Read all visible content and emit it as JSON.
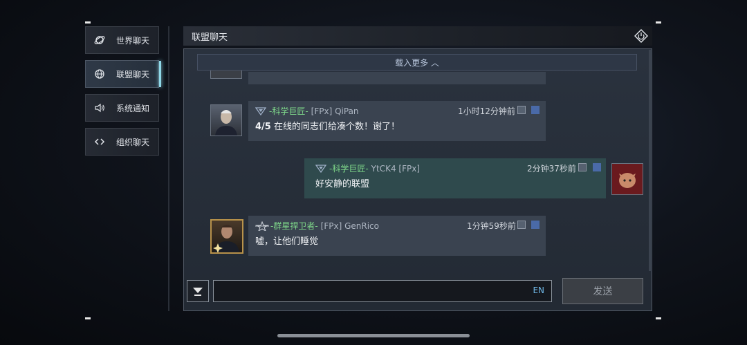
{
  "sidebar": {
    "items": [
      {
        "label": "世界聊天",
        "icon": "globe-orbit-icon"
      },
      {
        "label": "联盟聊天",
        "icon": "globe-icon",
        "active": true
      },
      {
        "label": "系统通知",
        "icon": "speaker-icon"
      },
      {
        "label": "组织聊天",
        "icon": "link-icon"
      }
    ]
  },
  "header": {
    "title": "联盟聊天",
    "exit_icon": "exit-diamond-icon"
  },
  "load_more": "载入更多 ︿",
  "messages": [
    {
      "title": "-科学巨匠-",
      "player": "[FPx] QiPan",
      "time": "1小时12分钟前",
      "text_bold": "4/5",
      "text": " 在线的同志们给凑个数！谢了！",
      "side": "left"
    },
    {
      "title": "-科学巨匠-",
      "player": "YtCK4 [FPx]",
      "time": "2分钟37秒前",
      "text": "好安静的联盟",
      "side": "right"
    },
    {
      "title": "-群星捍卫者-",
      "player": "[FPx] GenRico",
      "time": "1分钟59秒前",
      "text": "嘘，让他们睡觉",
      "side": "left"
    }
  ],
  "input": {
    "lang": "EN",
    "value": ""
  },
  "send_label": "发送",
  "colors": {
    "title_green": "#7fd98a",
    "accent_cyan": "#8fd8e8"
  }
}
